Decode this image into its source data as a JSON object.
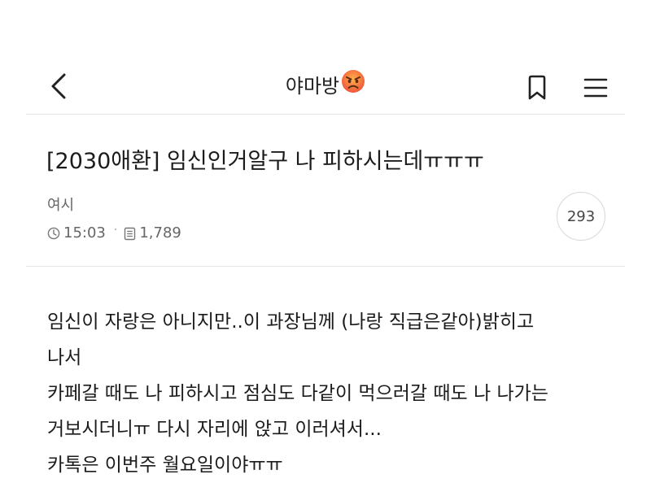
{
  "header": {
    "board_name": "야마방",
    "board_emoji_icon": "angry-face-icon",
    "back_icon": "chevron-left-icon",
    "bookmark_icon": "bookmark-icon",
    "menu_icon": "hamburger-menu-icon"
  },
  "post": {
    "title": "[2030애환] 임신인거알구 나 피하시는데ㅠㅠㅠ",
    "author": "여시",
    "time": "15:03",
    "views": "1,789",
    "comment_count": "293",
    "body_lines": [
      "임신이 자랑은 아니지만..이 과장님께 (나랑 직급은같아)밝히고",
      "나서",
      "카페갈 때도 나 피하시고 점심도 다같이 먹으러갈 때도 나 나가는",
      "거보시더니ㅠ 다시 자리에 앉고 이러셔서...",
      "카톡은 이번주 월요일이야ㅠㅠ"
    ]
  },
  "colors": {
    "text": "#1b1b1b",
    "meta": "#666666",
    "divider": "#e6e6e6",
    "emoji_face": "#f26a3d"
  }
}
